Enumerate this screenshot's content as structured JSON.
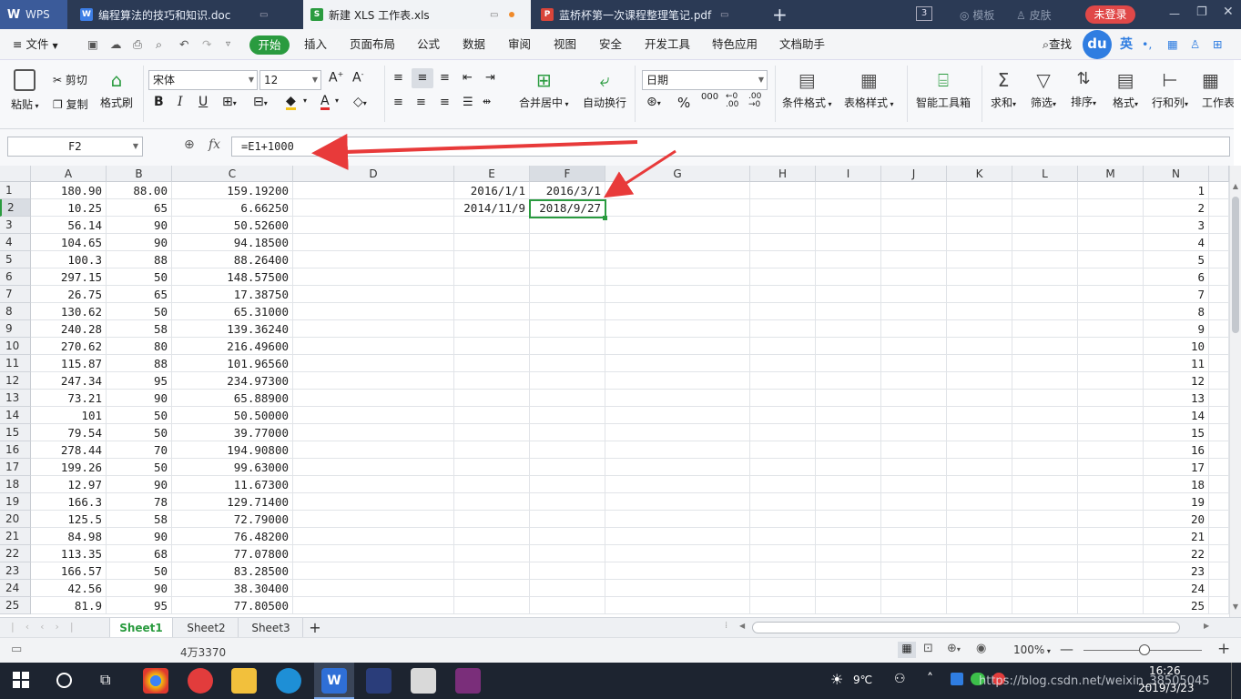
{
  "window_tabs": [
    {
      "label": "WPS"
    },
    {
      "label": "编程算法的技巧和知识.doc"
    },
    {
      "label": "新建 XLS 工作表.xls"
    },
    {
      "label": "蓝桥杯第一次课程整理笔记.pdf"
    }
  ],
  "titlebar": {
    "count_badge": "3",
    "template_label": "模板",
    "skin_label": "皮肤",
    "login_label": "未登录"
  },
  "menu": {
    "file_label": "文件",
    "start_label": "开始",
    "items": [
      "插入",
      "页面布局",
      "公式",
      "数据",
      "审阅",
      "视图",
      "安全",
      "开发工具",
      "特色应用",
      "文档助手"
    ],
    "search_label": "查找",
    "ime_label": "英"
  },
  "ribbon": {
    "paste": "粘贴",
    "cut": "剪切",
    "copy": "复制",
    "format_painter": "格式刷",
    "font_name": "宋体",
    "font_size": "12",
    "merge_center": "合并居中",
    "wrap_text": "自动换行",
    "number_format": "日期",
    "conditional_format": "条件格式",
    "table_style": "表格样式",
    "smart_toolbox": "智能工具箱",
    "sum": "求和",
    "filter": "筛选",
    "sort": "排序",
    "format": "格式",
    "row_col": "行和列",
    "worksheet": "工作表"
  },
  "formula_bar": {
    "name_box": "F2",
    "fx_label": "fx",
    "formula": "=E1+1000"
  },
  "columns": [
    "A",
    "B",
    "C",
    "D",
    "E",
    "F",
    "G",
    "H",
    "I",
    "J",
    "K",
    "L",
    "M",
    "N"
  ],
  "rows": [
    {
      "n": "1",
      "a": "180.90",
      "b": "88.00",
      "c": "159.19200",
      "e": "2016/1/1",
      "f": "2016/3/1"
    },
    {
      "n": "2",
      "a": "10.25",
      "b": "65",
      "c": "6.66250",
      "e": "2014/11/9",
      "f": "2018/9/27"
    },
    {
      "n": "3",
      "a": "56.14",
      "b": "90",
      "c": "50.52600"
    },
    {
      "n": "4",
      "a": "104.65",
      "b": "90",
      "c": "94.18500"
    },
    {
      "n": "5",
      "a": "100.3",
      "b": "88",
      "c": "88.26400"
    },
    {
      "n": "6",
      "a": "297.15",
      "b": "50",
      "c": "148.57500"
    },
    {
      "n": "7",
      "a": "26.75",
      "b": "65",
      "c": "17.38750"
    },
    {
      "n": "8",
      "a": "130.62",
      "b": "50",
      "c": "65.31000"
    },
    {
      "n": "9",
      "a": "240.28",
      "b": "58",
      "c": "139.36240"
    },
    {
      "n": "10",
      "a": "270.62",
      "b": "80",
      "c": "216.49600"
    },
    {
      "n": "11",
      "a": "115.87",
      "b": "88",
      "c": "101.96560"
    },
    {
      "n": "12",
      "a": "247.34",
      "b": "95",
      "c": "234.97300"
    },
    {
      "n": "13",
      "a": "73.21",
      "b": "90",
      "c": "65.88900"
    },
    {
      "n": "14",
      "a": "101",
      "b": "50",
      "c": "50.50000"
    },
    {
      "n": "15",
      "a": "79.54",
      "b": "50",
      "c": "39.77000"
    },
    {
      "n": "16",
      "a": "278.44",
      "b": "70",
      "c": "194.90800"
    },
    {
      "n": "17",
      "a": "199.26",
      "b": "50",
      "c": "99.63000"
    },
    {
      "n": "18",
      "a": "12.97",
      "b": "90",
      "c": "11.67300"
    },
    {
      "n": "19",
      "a": "166.3",
      "b": "78",
      "c": "129.71400"
    },
    {
      "n": "20",
      "a": "125.5",
      "b": "58",
      "c": "72.79000"
    },
    {
      "n": "21",
      "a": "84.98",
      "b": "90",
      "c": "76.48200"
    },
    {
      "n": "22",
      "a": "113.35",
      "b": "68",
      "c": "77.07800"
    },
    {
      "n": "23",
      "a": "166.57",
      "b": "50",
      "c": "83.28500"
    },
    {
      "n": "24",
      "a": "42.56",
      "b": "90",
      "c": "38.30400"
    },
    {
      "n": "25",
      "a": "81.9",
      "b": "95",
      "c": "77.80500"
    }
  ],
  "sheets": [
    "Sheet1",
    "Sheet2",
    "Sheet3"
  ],
  "status": {
    "sum_text": "4万3370",
    "zoom": "100%"
  },
  "taskbar": {
    "weather": "9℃",
    "time": "16:26",
    "date": "2019/3/23",
    "watermark": "https://blog.csdn.net/weixin_38505045"
  },
  "colors": {
    "accent_green": "#2a9b3f",
    "arrow_red": "#e83a3a",
    "titlebar": "#2b3a55",
    "login_red": "#e04848"
  }
}
